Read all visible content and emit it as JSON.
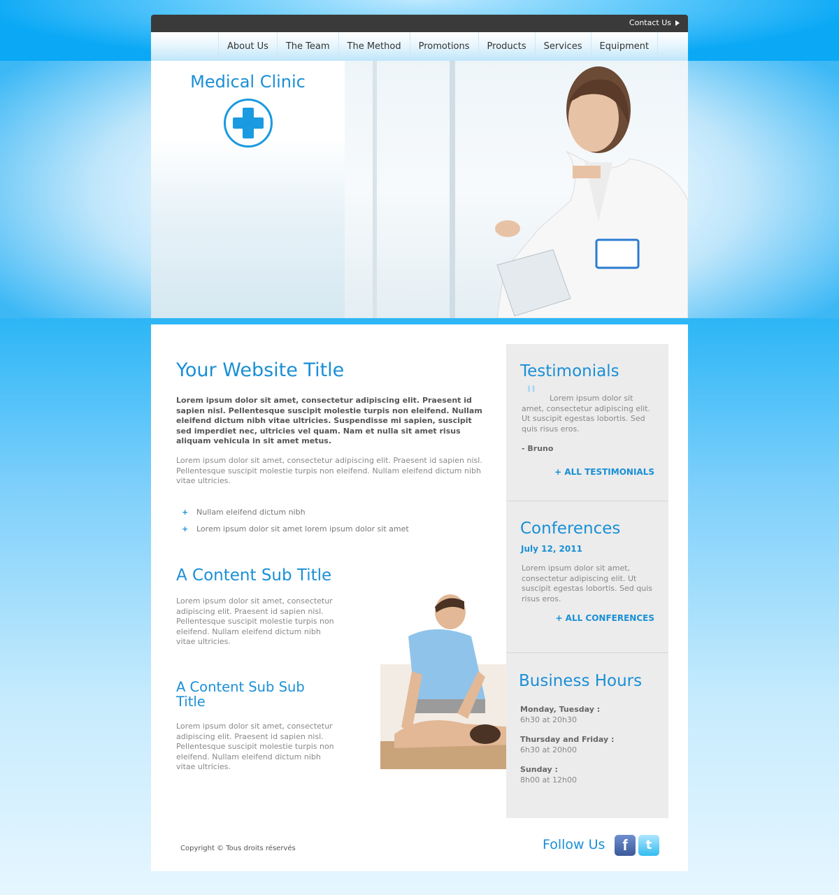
{
  "header": {
    "contact_label": "Contact Us",
    "nav": [
      "About Us",
      "The Team",
      "The Method",
      "Promotions",
      "Products",
      "Services",
      "Equipment"
    ]
  },
  "hero": {
    "brand": "Medical Clinic"
  },
  "main": {
    "title": "Your Website Title",
    "lead": "Lorem ipsum dolor sit amet, consectetur adipiscing elit. Praesent id sapien nisl. Pellentesque suscipit molestie turpis non eleifend. Nullam eleifend dictum nibh vitae ultricies. Suspendisse mi sapien, suscipit sed imperdiet nec, ultricies vel quam. Nam et nulla sit amet risus aliquam vehicula in sit amet metus.",
    "paragraph": "Lorem ipsum dolor sit amet, consectetur adipiscing elit. Praesent id sapien nisl. Pellentesque suscipit molestie turpis non eleifend. Nullam eleifend dictum nibh vitae ultricies.",
    "bullets": [
      "Nullam eleifend dictum nibh",
      "Lorem ipsum dolor sit amet lorem ipsum dolor sit amet"
    ],
    "sub_title": "A Content Sub Title",
    "sub_paragraph": "Lorem ipsum dolor sit amet, consectetur adipiscing elit. Praesent id sapien nisl. Pellentesque suscipit molestie turpis non eleifend. Nullam eleifend dictum nibh vitae ultricies.",
    "sub_sub_title": "A Content Sub Sub Title",
    "sub_sub_paragraph": "Lorem ipsum dolor sit amet, consectetur adipiscing elit. Praesent id sapien nisl. Pellentesque suscipit molestie turpis non eleifend. Nullam eleifend dictum nibh vitae ultricies."
  },
  "sidebar": {
    "testimonials": {
      "title": "Testimonials",
      "quote": "Lorem ipsum dolor sit amet, consectetur adipiscing elit. Ut suscipit egestas lobortis. Sed quis risus eros.",
      "author": "- Bruno",
      "link": "+  ALL TESTIMONIALS"
    },
    "conferences": {
      "title": "Conferences",
      "date": "July 12, 2011",
      "text": "Lorem ipsum dolor sit amet, consectetur adipiscing elit. Ut suscipit egestas lobortis. Sed quis risus eros.",
      "link": "+  ALL CONFERENCES"
    },
    "hours": {
      "title": "Business Hours",
      "rows": [
        {
          "day": "Monday, Tuesday :",
          "time": "6h30 at 20h30"
        },
        {
          "day": "Thursday and Friday :",
          "time": "6h30 at 20h00"
        },
        {
          "day": "Sunday :",
          "time": "8h00 at 12h00"
        }
      ]
    }
  },
  "footer": {
    "copyright": "Copyright © Tous droits réservés",
    "follow": "Follow Us",
    "facebook_glyph": "f",
    "twitter_glyph": "t"
  },
  "colors": {
    "accent": "#1a8fd6",
    "background": "#0aa8f5",
    "topbar": "#3a3a3a",
    "sidebar": "#ececec"
  }
}
